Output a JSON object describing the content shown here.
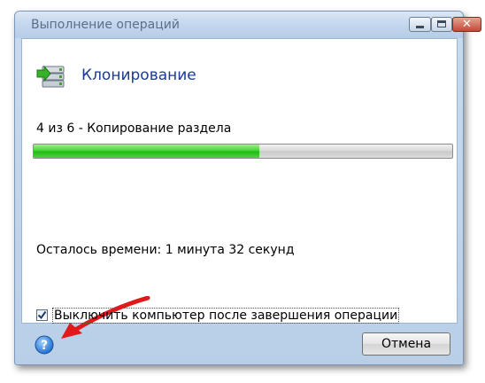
{
  "window": {
    "title": "Выполнение операций",
    "close_glyph": "✕"
  },
  "operation": {
    "title": "Клонирование",
    "icon": "clone-disk-icon",
    "step_text": "4 из 6 - Копирование раздела",
    "progress_percent": 54,
    "time_left": "Осталось времени: 1 минута 32 секунд"
  },
  "options": {
    "shutdown_label": "Выключить компьютер после завершения операции",
    "shutdown_checked": true
  },
  "footer": {
    "help_icon": "help-icon",
    "help_glyph": "?",
    "cancel_label": "Отмена"
  },
  "colors": {
    "progress_fill": "#2fc424",
    "title_accent": "#1a3d8f",
    "annotation_arrow": "#e01a1a"
  }
}
